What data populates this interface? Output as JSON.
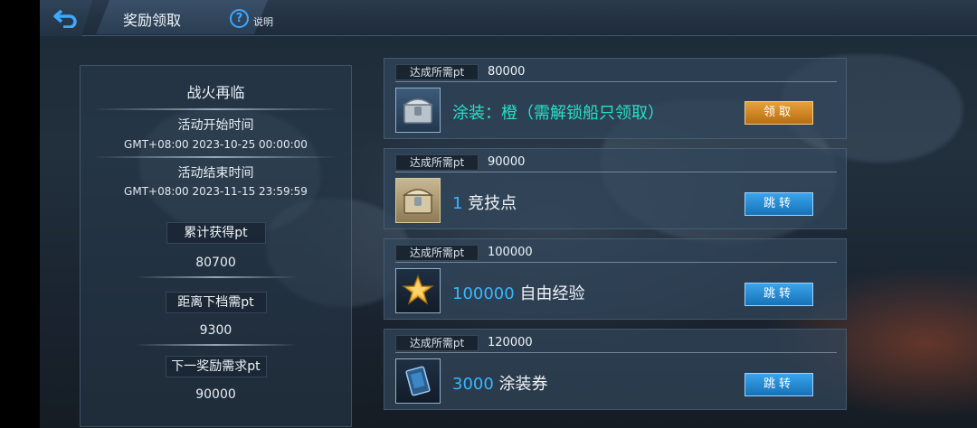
{
  "header": {
    "title": "奖励领取",
    "help_label": "说明",
    "help_icon": "?"
  },
  "event": {
    "name": "战火再临",
    "start_label": "活动开始时间",
    "start_value": "GMT+08:00 2023-10-25 00:00:00",
    "end_label": "活动结束时间",
    "end_value": "GMT+08:00 2023-11-15 23:59:59"
  },
  "stats": {
    "total_label": "累计获得pt",
    "total_value": "80700",
    "to_next_label": "距离下档需pt",
    "to_next_value": "9300",
    "next_req_label": "下一奖励需求pt",
    "next_req_value": "90000"
  },
  "rewards": [
    {
      "req_label": "达成所需pt",
      "req_value": "80000",
      "amount": "",
      "text": "涂装：橙（需解锁船只领取）",
      "button": "领取",
      "icon": "chest-icon"
    },
    {
      "req_label": "达成所需pt",
      "req_value": "90000",
      "amount": "1",
      "text": " 竞技点",
      "button": "跳转",
      "icon": "chest-icon"
    },
    {
      "req_label": "达成所需pt",
      "req_value": "100000",
      "amount": "100000",
      "text": " 自由经验",
      "button": "跳转",
      "icon": "star-icon"
    },
    {
      "req_label": "达成所需pt",
      "req_value": "120000",
      "amount": "3000",
      "text": " 涂装券",
      "button": "跳转",
      "icon": "coupon-icon"
    }
  ],
  "colors": {
    "accent": "#36b8ff",
    "gold_button": "#d48a26",
    "blue_button": "#2a8ad6",
    "teal_text": "#27e0c8"
  }
}
